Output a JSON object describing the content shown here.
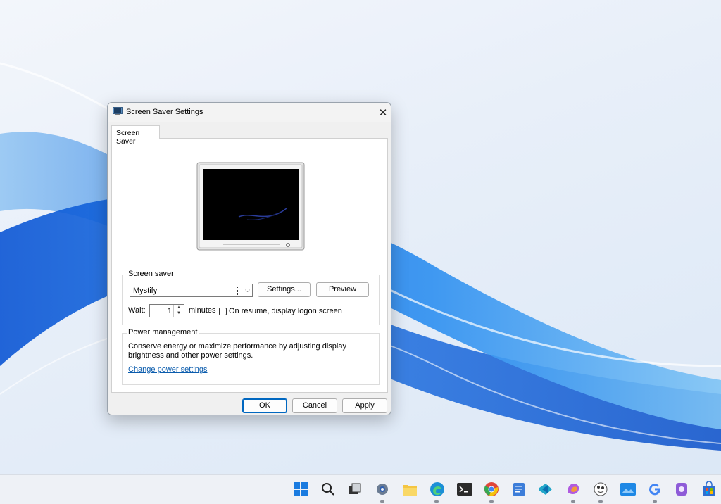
{
  "window": {
    "title": "Screen Saver Settings"
  },
  "tabs": [
    {
      "label": "Screen Saver"
    }
  ],
  "screen_saver": {
    "legend": "Screen saver",
    "selected": "Mystify",
    "settings_button": "Settings...",
    "preview_button": "Preview",
    "wait_label": "Wait:",
    "wait_value": "1",
    "minutes_label": "minutes",
    "resume_label": "On resume, display logon screen",
    "resume_checked": false
  },
  "power": {
    "legend": "Power management",
    "description": "Conserve energy or maximize performance by adjusting display brightness and other power settings.",
    "link": "Change power settings"
  },
  "buttons": {
    "ok": "OK",
    "cancel": "Cancel",
    "apply": "Apply"
  },
  "taskbar": {
    "icons": [
      "start-icon",
      "search-icon",
      "task-view-icon",
      "settings-icon",
      "file-explorer-icon",
      "edge-icon",
      "terminal-icon",
      "chrome-icon",
      "notepad-icon",
      "vscode-icon",
      "copilot-icon",
      "paint-icon",
      "photos-icon",
      "google-icon",
      "app-icon",
      "store-icon"
    ]
  },
  "colors": {
    "accent": "#0067c0",
    "link": "#0b5cad"
  }
}
